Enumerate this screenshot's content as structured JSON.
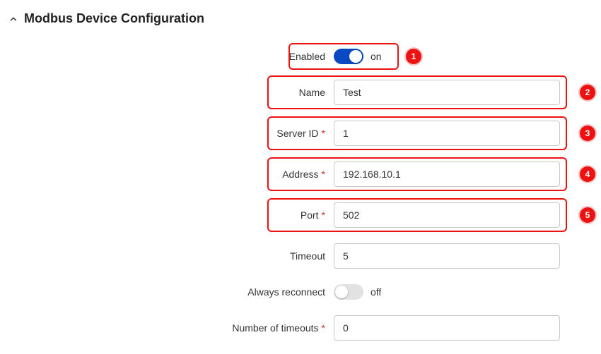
{
  "section": {
    "title": "Modbus Device Configuration"
  },
  "fields": {
    "enabled": {
      "label": "Enabled",
      "state_text": "on",
      "on": true,
      "step": "1"
    },
    "name": {
      "label": "Name",
      "value": "Test",
      "step": "2"
    },
    "server_id": {
      "label": "Server ID",
      "value": "1",
      "step": "3",
      "required": true
    },
    "address": {
      "label": "Address",
      "value": "192.168.10.1",
      "step": "4",
      "required": true
    },
    "port": {
      "label": "Port",
      "value": "502",
      "step": "5",
      "required": true
    },
    "timeout": {
      "label": "Timeout",
      "value": "5"
    },
    "reconnect": {
      "label": "Always reconnect",
      "state_text": "off",
      "on": false
    },
    "num_to": {
      "label": "Number of timeouts",
      "value": "0",
      "required": true
    }
  },
  "req_mark": "*"
}
